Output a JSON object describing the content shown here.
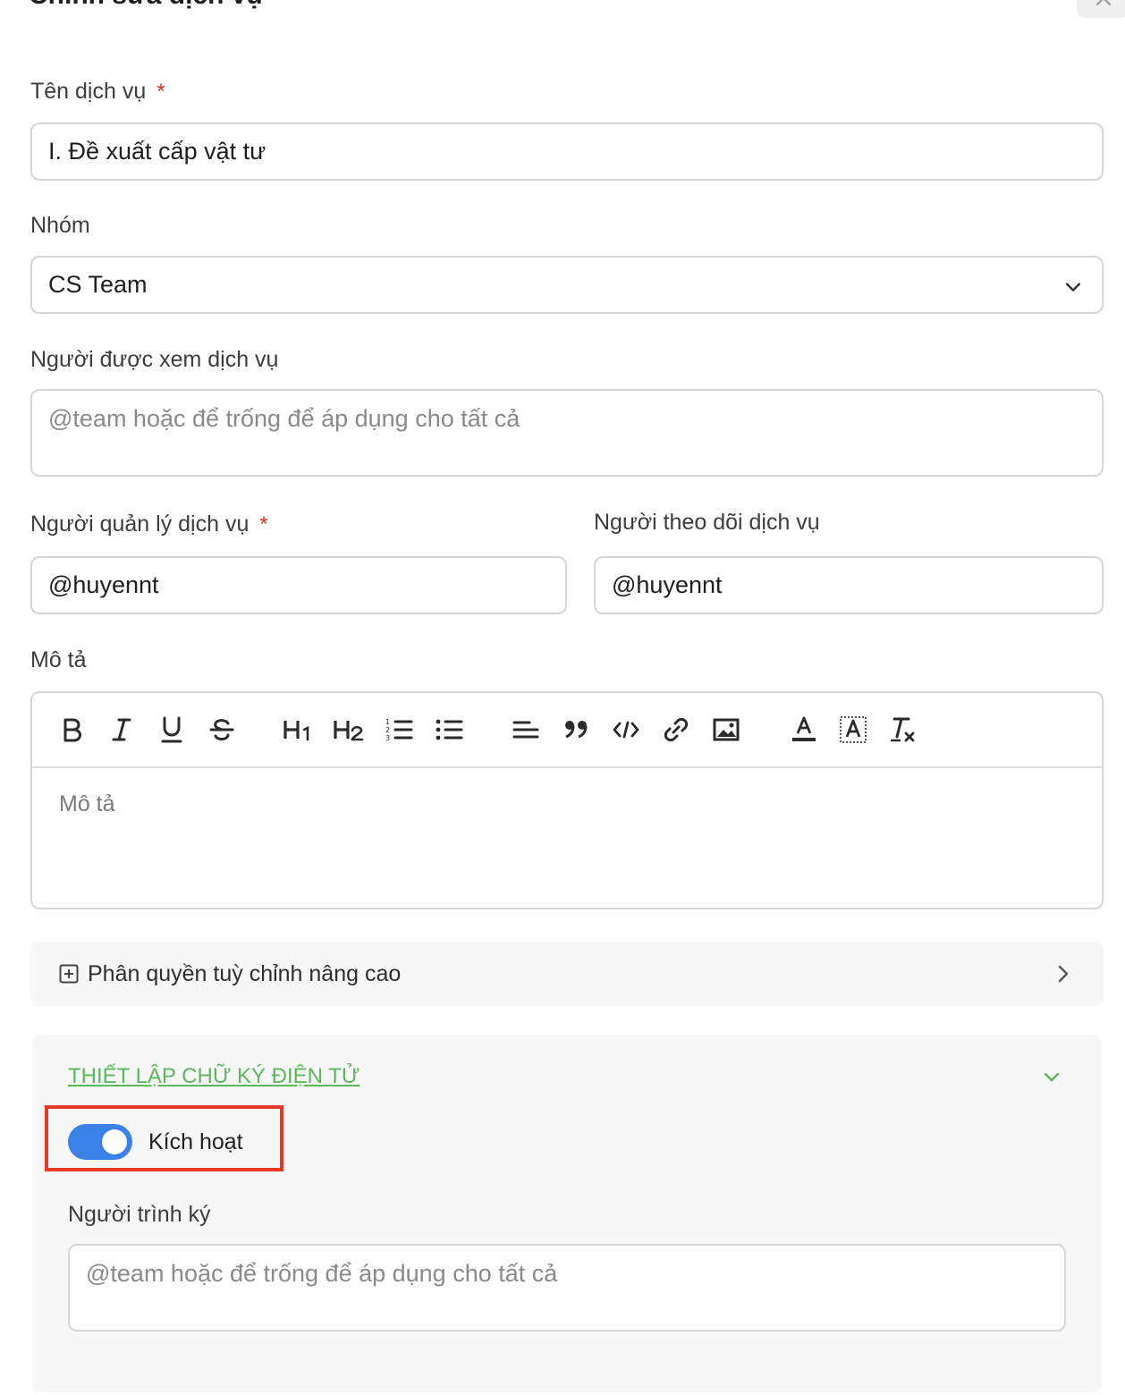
{
  "dialog": {
    "title": "Chỉnh sửa dịch vụ",
    "close_icon": "close-icon"
  },
  "fields": {
    "service_name": {
      "label": "Tên dịch vụ",
      "required_mark": "*",
      "value": "I. Đề xuất cấp vật tư"
    },
    "group": {
      "label": "Nhóm",
      "value": "CS Team",
      "icon": "chevron-down-icon"
    },
    "viewers": {
      "label": "Người được xem dịch vụ",
      "placeholder": "@team hoặc để trống để áp dụng cho tất cả"
    },
    "manager": {
      "label": "Người quản lý dịch vụ",
      "required_mark": "*",
      "value": "@huyennt"
    },
    "follower": {
      "label": "Người theo dõi dịch vụ",
      "value": "@huyennt"
    },
    "description": {
      "label": "Mô tả",
      "placeholder": "Mô tả",
      "toolbar": [
        "bold-icon",
        "italic-icon",
        "underline-icon",
        "strikethrough-icon",
        "heading-1-icon",
        "heading-2-icon",
        "ordered-list-icon",
        "bullet-list-icon",
        "align-icon",
        "quote-icon",
        "code-icon",
        "link-icon",
        "image-icon",
        "text-color-icon",
        "highlight-color-icon",
        "clear-format-icon"
      ]
    }
  },
  "advanced_permissions": {
    "label": "Phân quyền tuỳ chỉnh nâng cao",
    "icon": "plus-square-icon",
    "arrow_icon": "chevron-right-icon"
  },
  "esign": {
    "title": "THIẾT LẬP CHỮ KÝ ĐIỆN TỬ",
    "title_color": "#5cb85c",
    "collapse_icon": "chevron-down-icon",
    "toggle_label": "Kích hoạt",
    "toggle_on": true,
    "toggle_color": "#3b82e8",
    "submitter": {
      "label": "Người trình ký",
      "placeholder": "@team hoặc để trống để áp dụng cho tất cả"
    }
  },
  "highlight_color": "#e53a27"
}
